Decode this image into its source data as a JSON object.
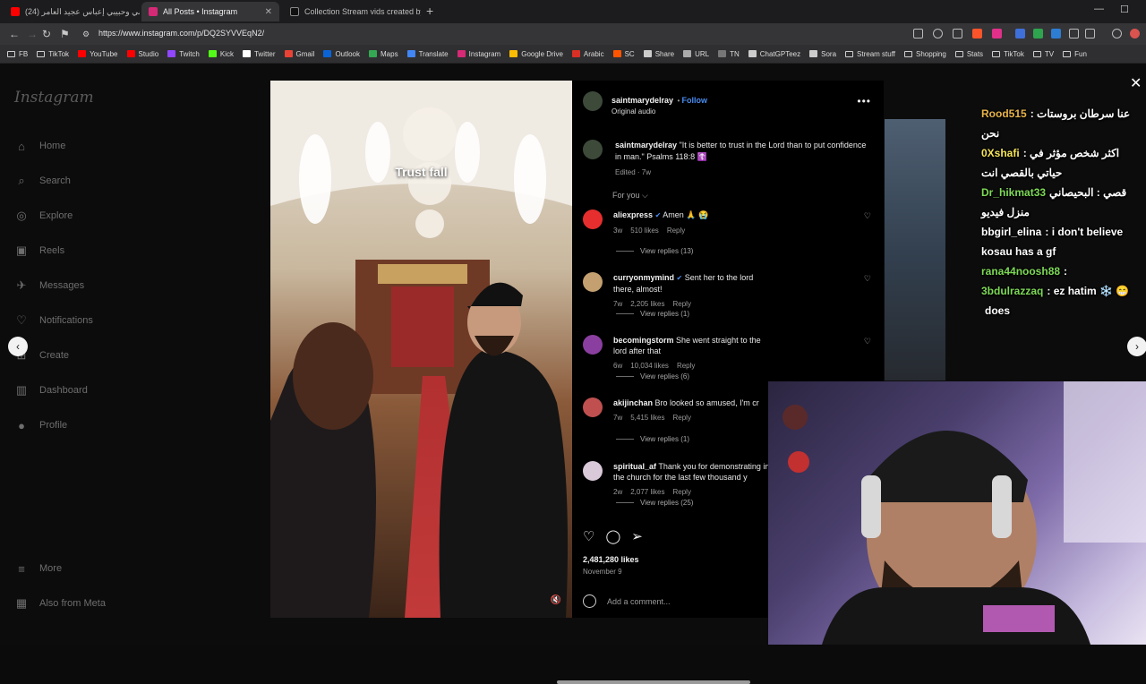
{
  "browser": {
    "tabs": [
      {
        "label": "(24) إماسي وحبيبي إعباس عجيد العامر...",
        "active": false,
        "favicon_color": "#ff0000"
      },
      {
        "label": "All Posts • Instagram",
        "active": true,
        "favicon_color": "#d62976"
      },
      {
        "label": "Collection Stream vids created by ko...",
        "active": false,
        "favicon_color": "#111111"
      }
    ],
    "new_tab": "+",
    "url": "https://www.instagram.com/p/DQ2SYVVEqN2/",
    "bookmarks": [
      "FB",
      "TikTok",
      "YouTube",
      "Studio",
      "Twitch",
      "Kick",
      "Twitter",
      "Gmail",
      "Outlook",
      "Maps",
      "Translate",
      "Instagram",
      "Google Drive",
      "Arabic",
      "SC",
      "Share",
      "URL",
      "TN",
      "ChatGPTeez",
      "Sora",
      "Stream stuff",
      "Shopping",
      "Stats",
      "TikTok",
      "TV",
      "Fun"
    ]
  },
  "sidebar": {
    "logo": "Instagram",
    "items": [
      {
        "label": "Home",
        "icon": "home-icon",
        "glyph": "⌂"
      },
      {
        "label": "Search",
        "icon": "search-icon",
        "glyph": "⌕"
      },
      {
        "label": "Explore",
        "icon": "explore-icon",
        "glyph": "◎"
      },
      {
        "label": "Reels",
        "icon": "reels-icon",
        "glyph": "▣"
      },
      {
        "label": "Messages",
        "icon": "messages-icon",
        "glyph": "✈"
      },
      {
        "label": "Notifications",
        "icon": "heart-icon",
        "glyph": "♡"
      },
      {
        "label": "Create",
        "icon": "create-icon",
        "glyph": "⊞"
      },
      {
        "label": "Dashboard",
        "icon": "dashboard-icon",
        "glyph": "▥"
      },
      {
        "label": "Profile",
        "icon": "profile-icon",
        "glyph": "●"
      }
    ],
    "more": "More",
    "also_from_meta": "Also from Meta"
  },
  "video": {
    "caption": "Trust fall"
  },
  "post": {
    "username": "saintmarydelray",
    "follow": "Follow",
    "audio": "Original audio",
    "caption_user": "saintmarydelray",
    "caption_text": "\"It is better to trust in the Lord than to put confidence in man.\" Psalms 118:8 ☦️",
    "caption_meta": "Edited · 7w",
    "for_you": "For you ⌵",
    "comments": [
      {
        "user": "aliexpress",
        "verified": true,
        "text": "Amen 🙏 😭",
        "age": "3w",
        "likes": "510 likes",
        "reply": "Reply",
        "view_replies": "View replies (13)",
        "avatar_color": "#e62e2e"
      },
      {
        "user": "curryonmymind",
        "verified": true,
        "text": "Sent her to the lord there, almost!",
        "age": "7w",
        "likes": "2,205 likes",
        "reply": "Reply",
        "view_replies": "View replies (1)",
        "avatar_color": "#c4a070"
      },
      {
        "user": "becomingstorm",
        "verified": false,
        "text": "She went straight to the lord after that",
        "age": "6w",
        "likes": "10,034 likes",
        "reply": "Reply",
        "view_replies": "View replies (6)",
        "avatar_color": "#8a3fa0"
      },
      {
        "user": "akijinchan",
        "verified": false,
        "text": "Bro looked so amused, I'm cr",
        "age": "7w",
        "likes": "5,415 likes",
        "reply": "Reply",
        "view_replies": "View replies (1)",
        "avatar_color": "#c05050"
      },
      {
        "user": "spiritual_af",
        "verified": false,
        "text": "Thank you for demonstrating in the church for the last few thousand y",
        "age": "2w",
        "likes": "2,077 likes",
        "reply": "Reply",
        "view_replies": "View replies (25)",
        "avatar_color": "#d9c9d9"
      }
    ],
    "likes": "2,481,280 likes",
    "date": "November 9",
    "add_comment": "Add a comment..."
  },
  "chat": [
    {
      "user": "Rood515",
      "text": "عنا سرطان بروستات : نحن",
      "color": "#e6b34a"
    },
    {
      "user": "0Xshafi",
      "text": "اكثر شخص مؤثر في : حياتي بالقصي انت",
      "color": "#f5e35a"
    },
    {
      "user": "Dr_hikmat33",
      "text": "قصي : البحيصاني منزل فيديو",
      "color": "#7ed957"
    },
    {
      "user": "bbgirl_elina",
      "text": ": i don't believe kosau has a gf",
      "color": "#ffffff"
    },
    {
      "user": "rana44noosh88",
      "text": ":",
      "color": "#7ed957"
    },
    {
      "user": "3bdulrazzaq",
      "text": ": ez hatim ❄️ 😁",
      "color": "#7ed957"
    },
    {
      "user": "",
      "text": "does",
      "color": "#ffffff"
    }
  ]
}
